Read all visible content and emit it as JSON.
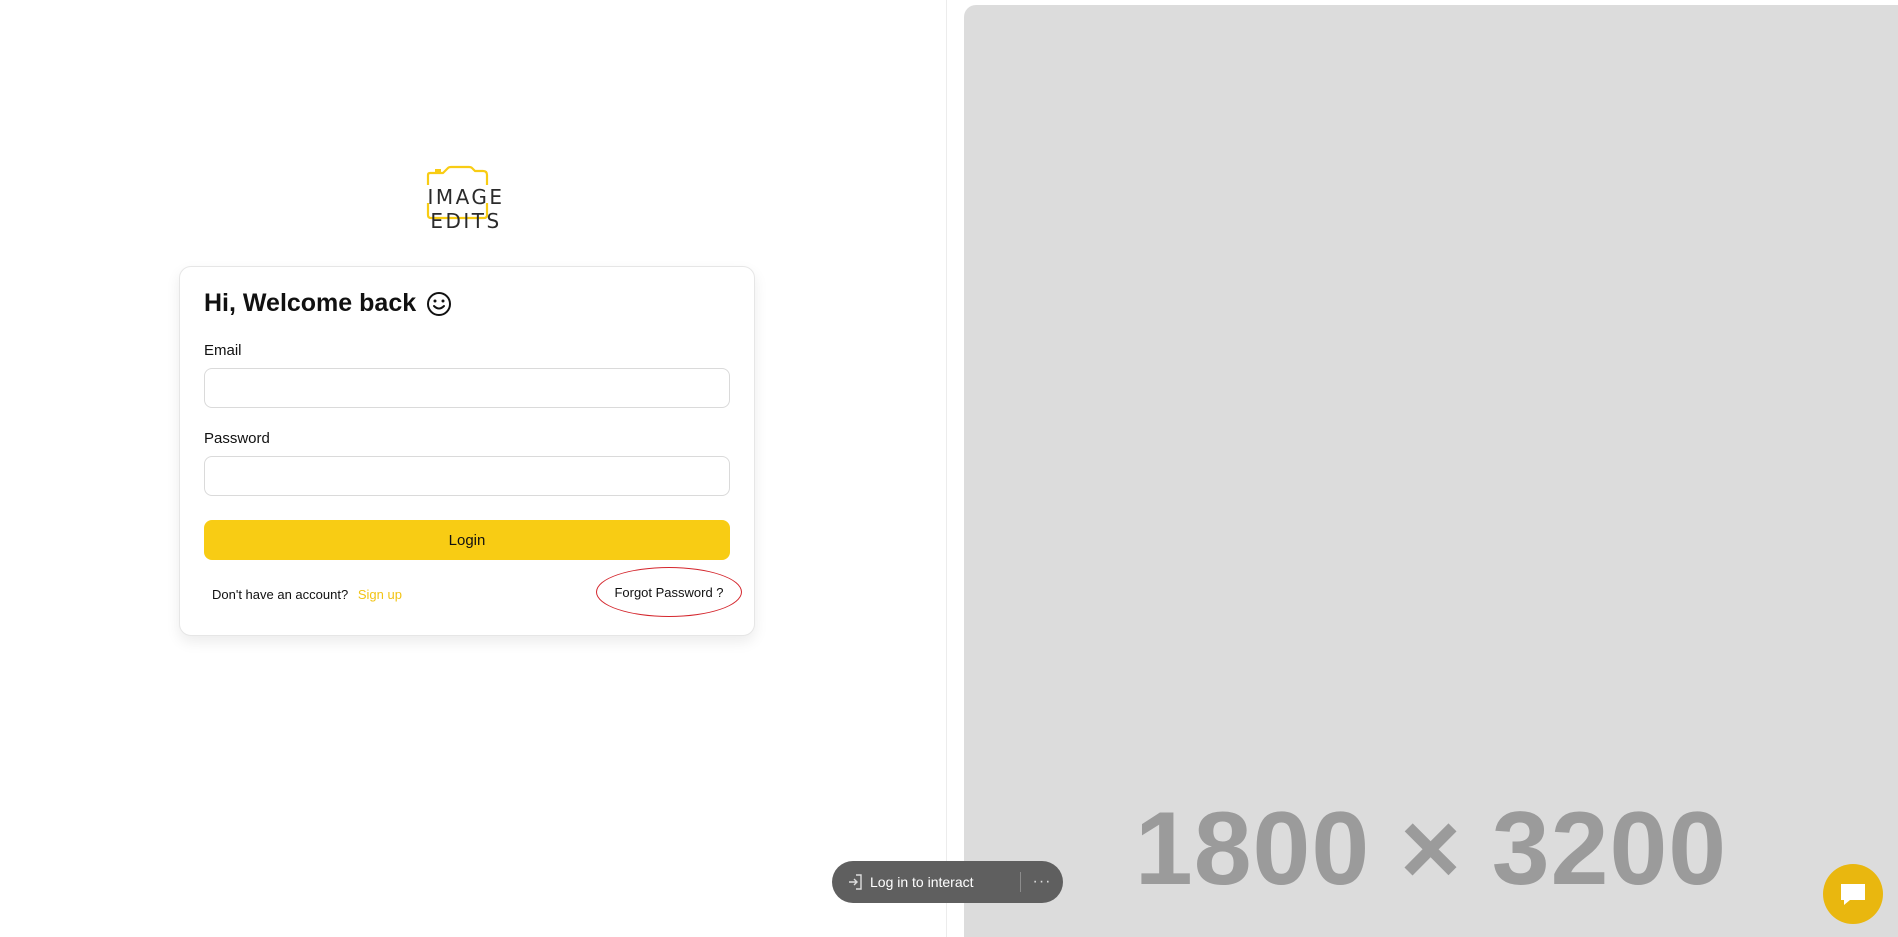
{
  "logo": {
    "text": "IMAGE EDITS",
    "accent": "#f8cc14"
  },
  "login_card": {
    "title": "Hi, Welcome back",
    "title_icon": "smile-icon",
    "email_label": "Email",
    "email_value": "",
    "password_label": "Password",
    "password_value": "",
    "login_label": "Login",
    "no_account_text": "Don't have an account?",
    "signup_label": "Sign up",
    "forgot_label": "Forgot Password ?"
  },
  "hero": {
    "placeholder_text": "1800 × 3200"
  },
  "interact_bar": {
    "login_icon": "login-arrow-icon",
    "label": "Log in to interact",
    "more_icon": "ellipsis-icon",
    "more_label": "···"
  },
  "chat": {
    "icon": "chat-bubble-icon"
  },
  "colors": {
    "brand_yellow": "#f8cc14",
    "link_yellow": "#f2c416",
    "annotation_red": "#d4262d",
    "placeholder_gray": "#dcdcdc"
  }
}
